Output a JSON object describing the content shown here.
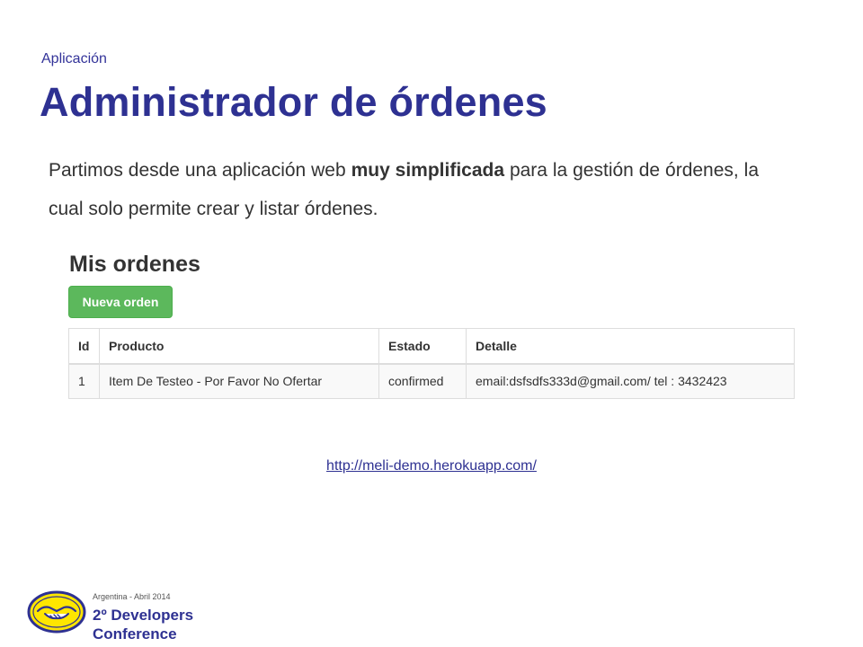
{
  "slide": {
    "kicker": "Aplicación",
    "title": "Administrador de órdenes",
    "body": {
      "part1": "Partimos desde una aplicación web ",
      "bold": "muy simplificada",
      "part2": " para la gestión de órdenes, la cual solo permite crear y listar órdenes."
    },
    "link": "http://meli-demo.herokuapp.com/"
  },
  "app": {
    "heading": "Mis ordenes",
    "new_button": "Nueva orden",
    "table": {
      "headers": [
        "Id",
        "Producto",
        "Estado",
        "Detalle"
      ],
      "rows": [
        [
          "1",
          "Item De Testeo - Por Favor No Ofertar",
          "confirmed",
          "email:dsfsdfs333d@gmail.com/ tel : 3432423"
        ]
      ]
    }
  },
  "footer": {
    "event_date": "Argentina - Abril 2014",
    "event_name_line1": "2º Developers",
    "event_name_line2": "Conference",
    "logo_icon": "handshake-logo-icon"
  },
  "colors": {
    "title": "#2e3192",
    "button": "#5cb85c",
    "logo_yellow": "#ffe600"
  }
}
